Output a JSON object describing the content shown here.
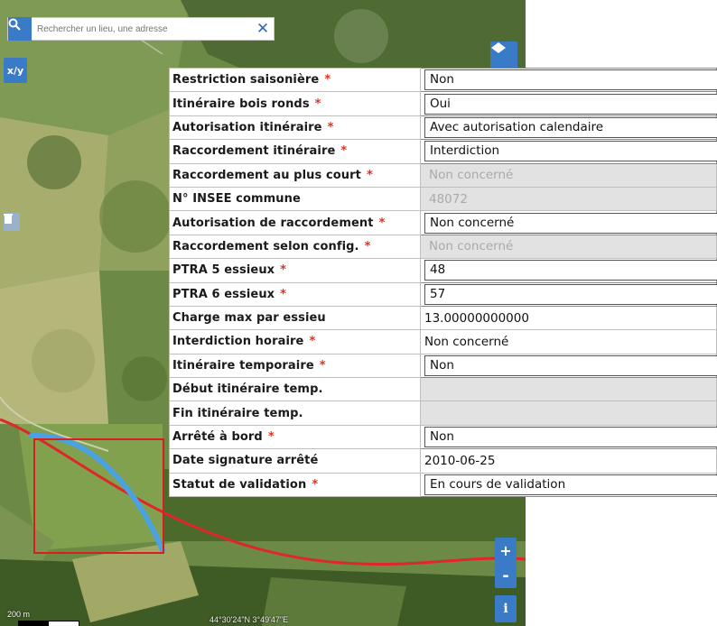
{
  "search": {
    "placeholder": "Rechercher un lieu, une adresse"
  },
  "map": {
    "xy_label": "x/y",
    "scale_label": "200 m",
    "coords": "44°30'24\"N 3°49'47\"E",
    "zoom_in": "+",
    "zoom_out": "-",
    "info": "i",
    "route_color": "#e0262a",
    "highlight_color": "#4aa3e0",
    "selection_color": "#d81e1e"
  },
  "required_marker": "*",
  "fields": [
    {
      "label": "Restriction saisonière",
      "required": true,
      "value": "Non",
      "kind": "field"
    },
    {
      "label": "Itinéraire bois ronds",
      "required": true,
      "value": "Oui",
      "kind": "field"
    },
    {
      "label": "Autorisation itinéraire",
      "required": true,
      "value": "Avec autorisation calendaire",
      "kind": "field"
    },
    {
      "label": "Raccordement itinéraire",
      "required": true,
      "value": "Interdiction",
      "kind": "field"
    },
    {
      "label": "Raccordement au plus court",
      "required": true,
      "value": "Non concerné",
      "kind": "disabled"
    },
    {
      "label": "N° INSEE commune",
      "required": false,
      "value": "48072",
      "kind": "disabled"
    },
    {
      "label": "Autorisation de raccordement",
      "required": true,
      "value": "Non concerné",
      "kind": "field"
    },
    {
      "label": "Raccordement selon config.",
      "required": true,
      "value": "Non concerné",
      "kind": "disabled"
    },
    {
      "label": "PTRA 5 essieux",
      "required": true,
      "value": "48",
      "kind": "field"
    },
    {
      "label": "PTRA 6 essieux",
      "required": true,
      "value": "57",
      "kind": "field"
    },
    {
      "label": "Charge max par essieu",
      "required": false,
      "value": "13.00000000000",
      "kind": "plain"
    },
    {
      "label": "Interdiction horaire",
      "required": true,
      "value": "Non concerné",
      "kind": "plain"
    },
    {
      "label": "Itinéraire temporaire",
      "required": true,
      "value": "Non",
      "kind": "field"
    },
    {
      "label": "Début itinéraire temp.",
      "required": false,
      "value": "",
      "kind": "disabled"
    },
    {
      "label": "Fin itinéraire temp.",
      "required": false,
      "value": "",
      "kind": "disabled"
    },
    {
      "label": "Arrêté à bord",
      "required": true,
      "value": "Non",
      "kind": "field"
    },
    {
      "label": "Date signature arrêté",
      "required": false,
      "value": "2010-06-25",
      "kind": "plain"
    },
    {
      "label": "Statut de validation",
      "required": true,
      "value": "En cours de validation",
      "kind": "field"
    }
  ]
}
